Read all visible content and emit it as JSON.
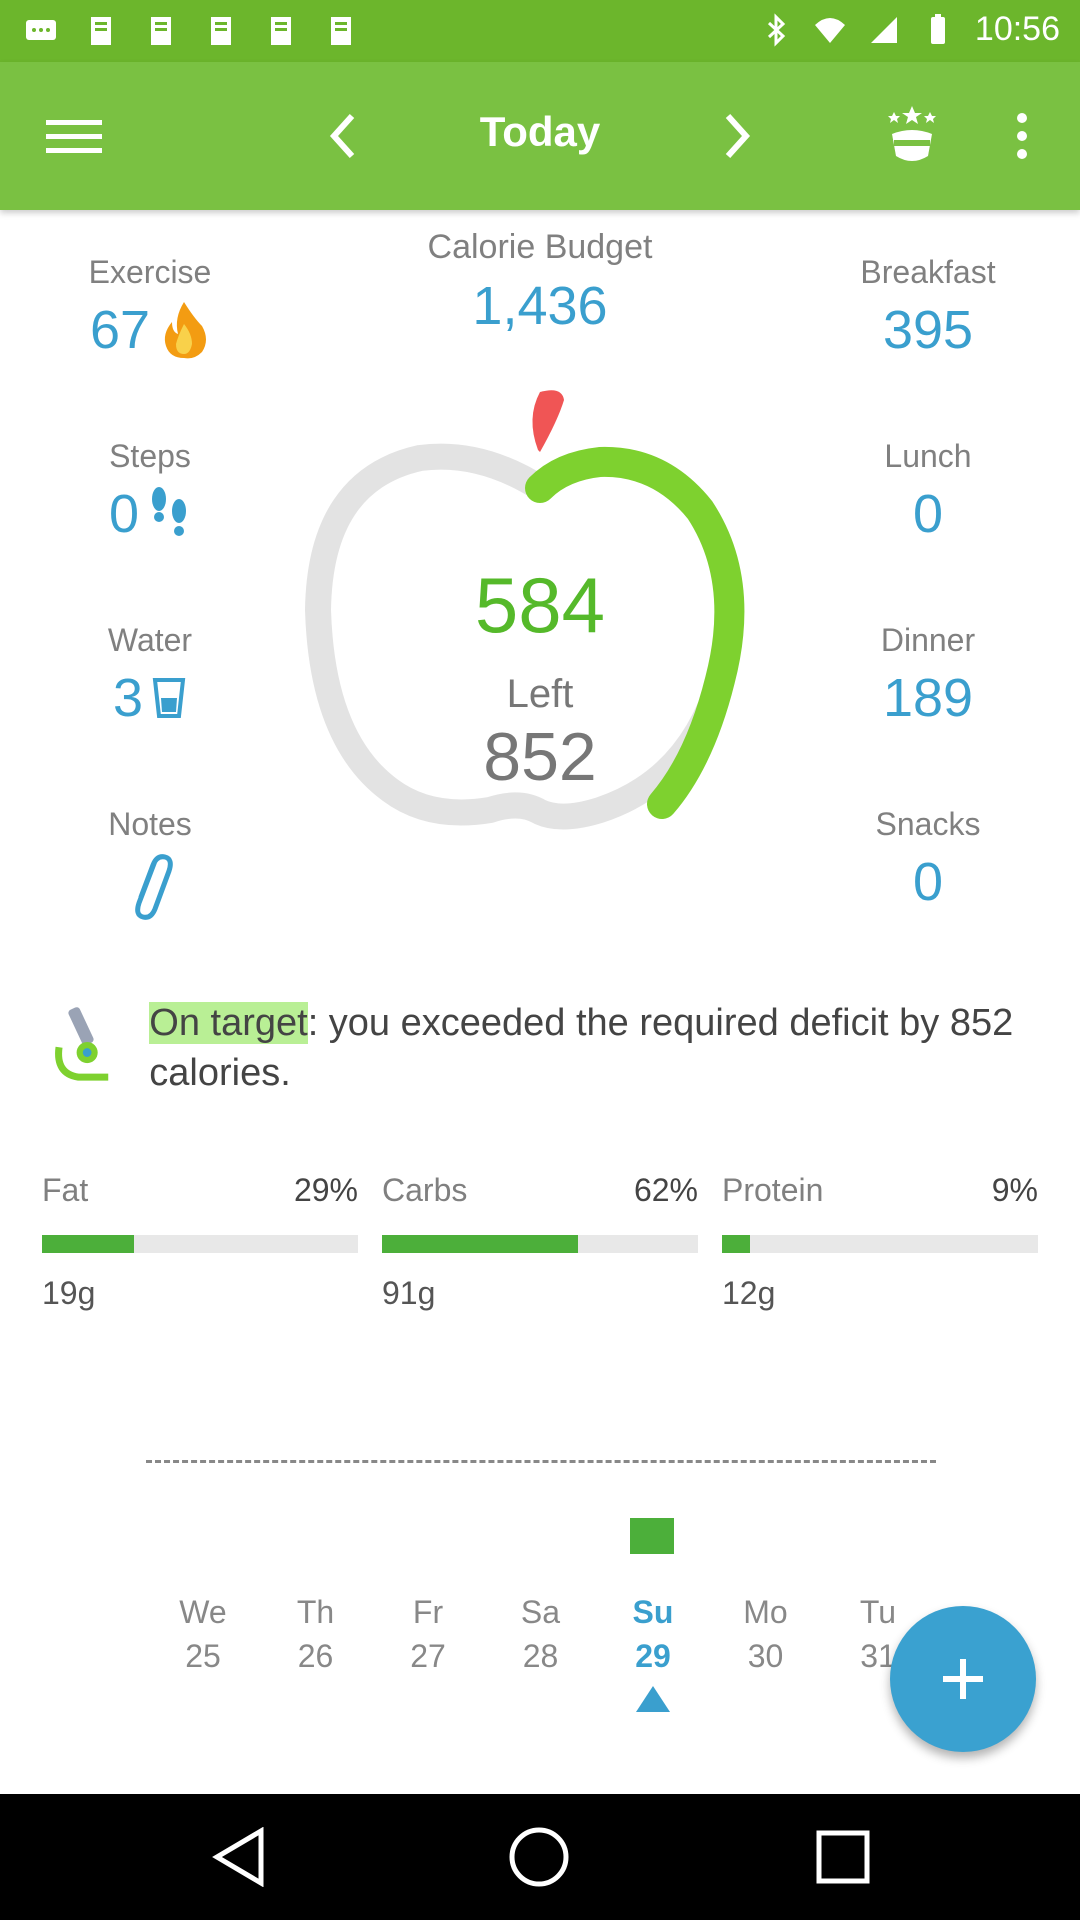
{
  "status_bar": {
    "time": "10:56",
    "colors": {
      "background": "#6cb62c"
    },
    "icons": [
      "message-icon",
      "notification-icon",
      "notification-icon",
      "notification-icon",
      "notification-icon",
      "notification-icon",
      "bluetooth-icon",
      "wifi-icon",
      "signal-icon",
      "battery-icon"
    ]
  },
  "app_bar": {
    "title": "Today",
    "colors": {
      "background": "#7ac142"
    },
    "icons": [
      "menu-icon",
      "chevron-left-icon",
      "chevron-right-icon",
      "achievement-icon",
      "more-vert-icon"
    ]
  },
  "stats": {
    "calorie_budget": {
      "label": "Calorie Budget",
      "value": "1,436"
    },
    "exercise": {
      "label": "Exercise",
      "value": "67",
      "icon": "flame-icon"
    },
    "steps": {
      "label": "Steps",
      "value": "0",
      "icon": "footsteps-icon"
    },
    "water": {
      "label": "Water",
      "value": "3",
      "icon": "glass-icon"
    },
    "notes": {
      "label": "Notes",
      "icon": "paperclip-icon"
    },
    "breakfast": {
      "label": "Breakfast",
      "value": "395"
    },
    "lunch": {
      "label": "Lunch",
      "value": "0"
    },
    "dinner": {
      "label": "Dinner",
      "value": "189"
    },
    "snacks": {
      "label": "Snacks",
      "value": "0"
    }
  },
  "apple_meter": {
    "consumed": "584",
    "left_label": "Left",
    "left_value": "852",
    "progress_fraction": 0.41,
    "colors": {
      "track": "#e3e3e3",
      "progress": "#7ed12f",
      "leaf": "#f05555"
    }
  },
  "target": {
    "highlight": "On target",
    "message": ": you exceeded the required deficit by 852 calories.",
    "icon": "microscope-icon"
  },
  "macros": [
    {
      "name": "Fat",
      "percent": "29%",
      "grams": "19g",
      "fill_percent": 29
    },
    {
      "name": "Carbs",
      "percent": "62%",
      "grams": "91g",
      "fill_percent": 62
    },
    {
      "name": "Protein",
      "percent": "9%",
      "grams": "12g",
      "fill_percent": 9
    }
  ],
  "week": {
    "days": [
      {
        "name": "We",
        "date": "25"
      },
      {
        "name": "Th",
        "date": "26"
      },
      {
        "name": "Fr",
        "date": "27"
      },
      {
        "name": "Sa",
        "date": "28"
      },
      {
        "name": "Su",
        "date": "29",
        "active": true
      },
      {
        "name": "Mo",
        "date": "30"
      },
      {
        "name": "Tu",
        "date": "31"
      }
    ]
  },
  "fab": {
    "icon": "plus-icon",
    "color": "#3aa1d0"
  },
  "nav_bar": {
    "icons": [
      "back-icon",
      "home-icon",
      "recents-icon"
    ]
  }
}
